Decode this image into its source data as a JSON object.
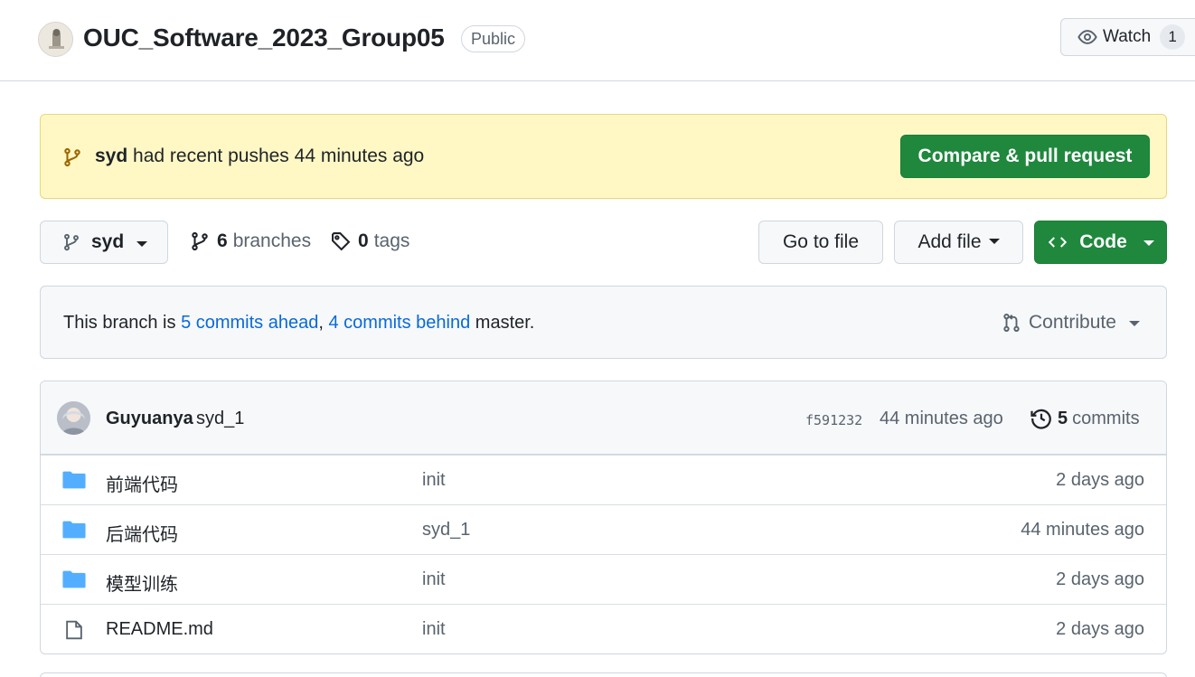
{
  "header": {
    "repo_name": "OUC_Software_2023_Group05",
    "visibility": "Public",
    "watch_label": "Watch",
    "watch_count": "1"
  },
  "banner": {
    "user": "syd",
    "message": " had recent pushes 44 minutes ago",
    "compare_label": "Compare & pull request"
  },
  "toolbar": {
    "branch": "syd",
    "branches_count": "6",
    "branches_label": "branches",
    "tags_count": "0",
    "tags_label": "tags",
    "goto_label": "Go to file",
    "addfile_label": "Add file",
    "code_label": "Code"
  },
  "branch_status": {
    "prefix": "This branch is ",
    "ahead": "5 commits ahead",
    "separator": ", ",
    "behind": "4 commits behind",
    "suffix": " master.",
    "contribute_label": "Contribute"
  },
  "latest_commit": {
    "author": "Guyuanya",
    "message": "syd_1",
    "sha": "f591232",
    "time": "44 minutes ago",
    "commits_count": "5",
    "commits_label": "commits"
  },
  "files": [
    {
      "name": "前端代码",
      "type": "folder",
      "commit": "init",
      "age": "2 days ago"
    },
    {
      "name": "后端代码",
      "type": "folder",
      "commit": "syd_1",
      "age": "44 minutes ago"
    },
    {
      "name": "模型训练",
      "type": "folder",
      "commit": "init",
      "age": "2 days ago"
    },
    {
      "name": "README.md",
      "type": "file",
      "commit": "init",
      "age": "2 days ago"
    }
  ],
  "colors": {
    "primary_green": "#1f883d",
    "link_blue": "#0969da",
    "folder_blue": "#54aeff",
    "banner_yellow": "#fff8c5"
  }
}
